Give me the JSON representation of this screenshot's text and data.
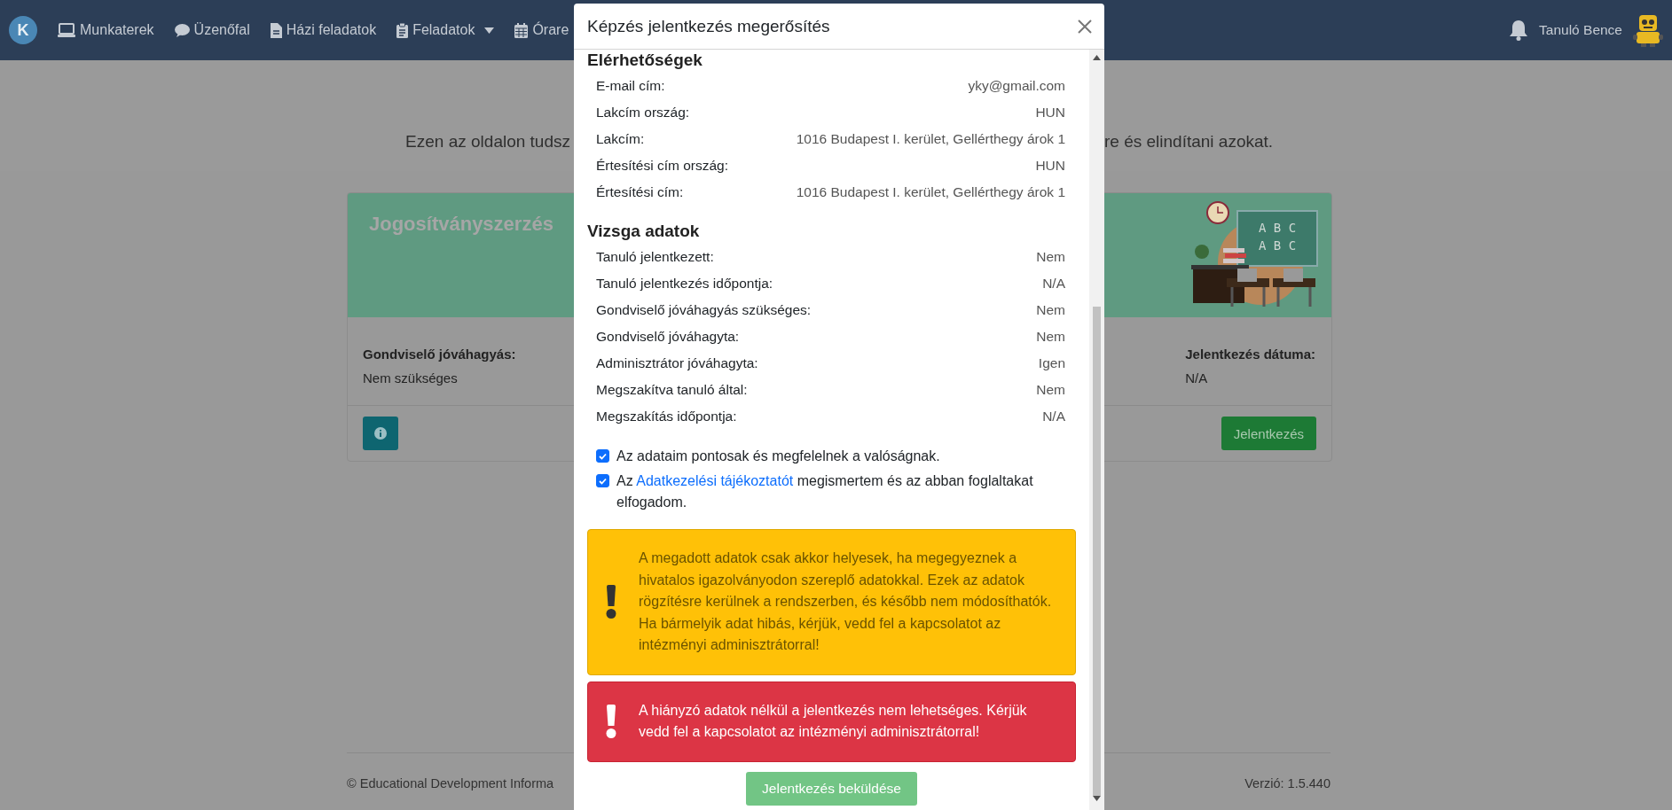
{
  "navbar": {
    "logo": "K",
    "items": [
      {
        "label": "Munkaterek",
        "dropdown": false
      },
      {
        "label": "Üzenőfal",
        "dropdown": false
      },
      {
        "label": "Házi feladatok",
        "dropdown": false
      },
      {
        "label": "Feladatok",
        "dropdown": true
      },
      {
        "label": "Órare",
        "dropdown": false
      }
    ],
    "user_name": "Tanuló Bence"
  },
  "page": {
    "intro_left": "Ezen az oldalon tudsz",
    "intro_right": "re és elindítani azokat.",
    "card": {
      "title": "Jogosítványszerzés",
      "board_lines": [
        "A B C",
        "A B C"
      ],
      "fields": [
        {
          "label": "Gondviselő jóváhagyás:",
          "value": "Nem szükséges"
        },
        {
          "label": "Jelentkezés dátuma:",
          "value": "N/A"
        }
      ],
      "action_button": "Jelentkezés"
    },
    "footer": {
      "copyright": "© Educational Development Informa",
      "version": "Verzió: 1.5.440"
    }
  },
  "modal": {
    "title": "Képzés jelentkezés megerősítés",
    "sections": [
      {
        "heading": "Elérhetőségek",
        "rows": [
          {
            "label": "E-mail cím:",
            "value": "yky@gmail.com"
          },
          {
            "label": "Lakcím ország:",
            "value": "HUN"
          },
          {
            "label": "Lakcím:",
            "value": "1016 Budapest I. kerület, Gellérthegy árok 1"
          },
          {
            "label": "Értesítési cím ország:",
            "value": "HUN"
          },
          {
            "label": "Értesítési cím:",
            "value": "1016 Budapest I. kerület, Gellérthegy árok 1"
          }
        ]
      },
      {
        "heading": "Vizsga adatok",
        "rows": [
          {
            "label": "Tanuló jelentkezett:",
            "value": "Nem"
          },
          {
            "label": "Tanuló jelentkezés időpontja:",
            "value": "N/A"
          },
          {
            "label": "Gondviselő jóváhagyás szükséges:",
            "value": "Nem"
          },
          {
            "label": "Gondviselő jóváhagyta:",
            "value": "Nem"
          },
          {
            "label": "Adminisztrátor jóváhagyta:",
            "value": "Igen"
          },
          {
            "label": "Megszakítva tanuló által:",
            "value": "Nem"
          },
          {
            "label": "Megszakítás időpontja:",
            "value": "N/A"
          }
        ]
      }
    ],
    "consents": [
      {
        "kind": "plain",
        "checked": true,
        "text": "Az adataim pontosak és megfelelnek a valóságnak."
      },
      {
        "kind": "link",
        "checked": true,
        "text_before": "Az",
        "link": "Adatkezelési tájékoztatót",
        "text_after": "megismertem és az abban foglaltakat elfogadom."
      }
    ],
    "alerts": [
      {
        "kind": "warning",
        "text": "A megadott adatok csak akkor helyesek, ha megegyeznek a hivatalos igazolványodon szereplő adatokkal. Ezek az adatok rögzítésre kerülnek a rendszerben, és később nem módosíthatók. Ha bármelyik adat hibás, kérjük, vedd fel a kapcsolatot az intézményi adminisztrátorral!"
      },
      {
        "kind": "danger",
        "text": "A hiányzó adatok nélkül a jelentkezés nem lehetséges. Kérjük vedd fel a kapcsolatot az intézményi adminisztrátorral!"
      }
    ],
    "submit_button": {
      "label": "Jelentkezés beküldése",
      "disabled": true
    }
  }
}
